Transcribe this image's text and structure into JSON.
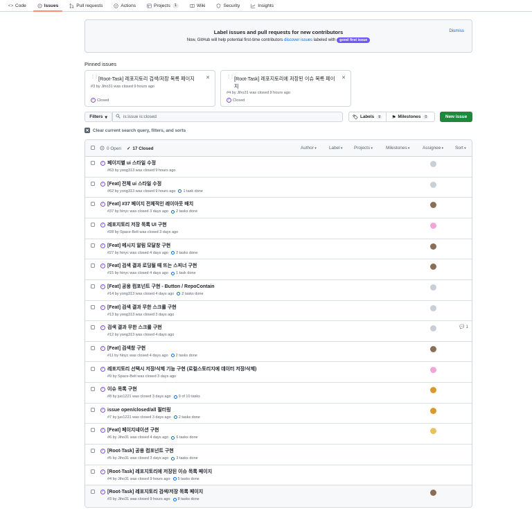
{
  "nav": [
    {
      "label": "Code",
      "icon": "code-icon"
    },
    {
      "label": "Issues",
      "icon": "issue-icon",
      "active": true
    },
    {
      "label": "Pull requests",
      "icon": "pull-request-icon"
    },
    {
      "label": "Actions",
      "icon": "play-icon"
    },
    {
      "label": "Projects",
      "icon": "table-icon",
      "count": "1"
    },
    {
      "label": "Wiki",
      "icon": "book-icon"
    },
    {
      "label": "Security",
      "icon": "shield-icon"
    },
    {
      "label": "Insights",
      "icon": "graph-icon"
    }
  ],
  "banner": {
    "title": "Label issues and pull requests for new contributors",
    "sub_prefix": "Now, GitHub will help potential first-time contributors",
    "sub_link": "discover issues",
    "sub_mid": "labeled with",
    "label": "good first issue",
    "dismiss": "Dismiss"
  },
  "pinned": {
    "title": "Pinned issues",
    "cards": [
      {
        "title": "[Root-Task] 레포지토리 검색/저장 목록 페이지",
        "meta": "#3 by Jiho31 was closed 9 hours ago",
        "status": "Closed"
      },
      {
        "title": "[Root-Task] 레포지토리에 저장된 이슈 목록 페이지",
        "meta": "#4 by Jiho31 was closed 9 hours ago",
        "status": "Closed"
      }
    ]
  },
  "filters": {
    "button": "Filters",
    "query": "is:issue is:closed",
    "labels": "Labels",
    "labels_count": "9",
    "milestones": "Milestones",
    "milestones_count": "0",
    "new_issue": "New issue",
    "clear": "Clear current search query, filters, and sorts"
  },
  "list_header": {
    "open": "0 Open",
    "closed": "17 Closed",
    "author": "Author",
    "label": "Label",
    "projects": "Projects",
    "milestones": "Milestones",
    "assignee": "Assignee",
    "sort": "Sort"
  },
  "issues": [
    {
      "title": "페이지별 ui 스타일 수정",
      "meta": "#63 by yong313 was closed 9 hours ago",
      "tasks": "",
      "avatar": "#c7d0d9"
    },
    {
      "title": "[Feat] 전체 ui 스타일 수정",
      "meta": "#62 by yong313 was closed 9 hours ago",
      "tasks": "1 task done",
      "avatar": "#c7d0d9"
    },
    {
      "title": "[Feat] #37 페이지 전체적인 레이아웃 배치",
      "meta": "#37 by hinyc was closed 3 days ago",
      "tasks": "2 tasks done",
      "avatar": "#8a6e56"
    },
    {
      "title": "레포지토리 저장 목록 UI 구현",
      "meta": "#28 by Space-Belt was closed 3 days ago",
      "tasks": "",
      "avatar": "#f0a6d8"
    },
    {
      "title": "[Feat] 메시지 알림 모달창 구현",
      "meta": "#27 by hinyc was closed 4 days ago",
      "tasks": "2 tasks done",
      "avatar": "#8a6e56"
    },
    {
      "title": "[Feat] 검색 결과 로딩될 때 뜨는 스피너 구현",
      "meta": "#15 by hinyc was closed 4 days ago",
      "tasks": "1 task done",
      "avatar": "#8a6e56"
    },
    {
      "title": "[Feat] 공용 컴포넌트 구현 - Button / RepoContain",
      "meta": "#14 by yong313 was closed 4 days ago",
      "tasks": "2 tasks done",
      "avatar": "#c7d0d9"
    },
    {
      "title": "[Feat] 검색 결과 무한 스크롤 구현",
      "meta": "#13 by yong313 was closed 3 days ago",
      "tasks": "",
      "avatar": "#c7d0d9"
    },
    {
      "title": "검색 결과 무한 스크롤 구현",
      "meta": "#12 by yong313 was closed 4 days ago",
      "tasks": "",
      "avatar": "#c7d0d9",
      "comments": "1"
    },
    {
      "title": "[Feat] 검색창 구현",
      "meta": "#11 by hinyc was closed 4 days ago",
      "tasks": "2 tasks done",
      "avatar": "#8a6e56"
    },
    {
      "title": "레포지토리 선택시 저장/삭제 기능 구현 (로컬스토리지에 데이터 저장/삭제)",
      "meta": "#9 by Space-Belt was closed 3 days ago",
      "tasks": "",
      "avatar": "#f0a6d8"
    },
    {
      "title": "이슈 목록 구현",
      "meta": "#8 by juo1221 was closed 3 days ago",
      "tasks": "9 of 10 tasks",
      "avatar": "#d99a2b"
    },
    {
      "title": "issue open/closed/all 필터링",
      "meta": "#7 by juo1221 was closed 3 days ago",
      "tasks": "2 tasks done",
      "avatar": "#d99a2b"
    },
    {
      "title": "[Feat] 페이지네이션 구현",
      "meta": "#6 by Jiho31 was closed 4 days ago",
      "tasks": "6 tasks done",
      "avatar": "#e8c25a"
    },
    {
      "title": "[Root-Task] 공용 컴포넌트 구현",
      "meta": "#5 by Jiho31 was closed 3 days ago",
      "tasks": "3 tasks done",
      "avatar": ""
    },
    {
      "title": "[Root-Task] 레포지토리에 저장된 이슈 목록 페이지",
      "meta": "#4 by Jiho31 was closed 9 hours ago",
      "tasks": "5 tasks done",
      "avatar": ""
    },
    {
      "title": "[Root-Task] 레포지토리 검색/저장 목록 페이지",
      "meta": "#3 by Jiho31 was closed 9 hours ago",
      "tasks": "8 tasks done",
      "avatar": "#8a6e56"
    }
  ]
}
